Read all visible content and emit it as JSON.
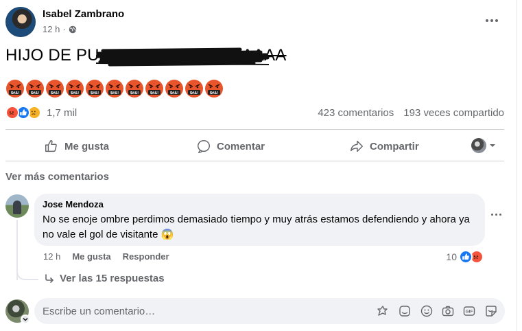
{
  "post": {
    "author": "Isabel Zambrano",
    "time": "12 h",
    "time_separator": "·",
    "text": "HIJO DE PU",
    "text_tail": "AAAA",
    "angry_emoji_count": 11,
    "angry_emoji_caption": "$#&!"
  },
  "reactions": {
    "count": "1,7 mil",
    "types": [
      "angry",
      "like",
      "sad"
    ],
    "comments": "423 comentarios",
    "shares": "193 veces compartido"
  },
  "actions": {
    "like": "Me gusta",
    "comment": "Comentar",
    "share": "Compartir"
  },
  "comments_section": {
    "see_more": "Ver más comentarios"
  },
  "comment": {
    "author": "Jose Mendoza",
    "text": "No se enoje ombre perdimos demasiado tiempo y muy atrás estamos defendiendo y ahora ya no vale el gol de visitante 😱",
    "time": "12 h",
    "like": "Me gusta",
    "reply": "Responder",
    "reaction_count": "10",
    "reaction_types": [
      "like",
      "angry"
    ],
    "view_replies": "Ver las 15 respuestas"
  },
  "composer": {
    "placeholder": "Escribe un comentario…"
  },
  "colors": {
    "like_blue": "#1877f2",
    "angry_orange": "#f5533d",
    "sad_yellow": "#f7b125",
    "secondary_text": "#65676b",
    "bubble_bg": "#f0f2f5"
  }
}
